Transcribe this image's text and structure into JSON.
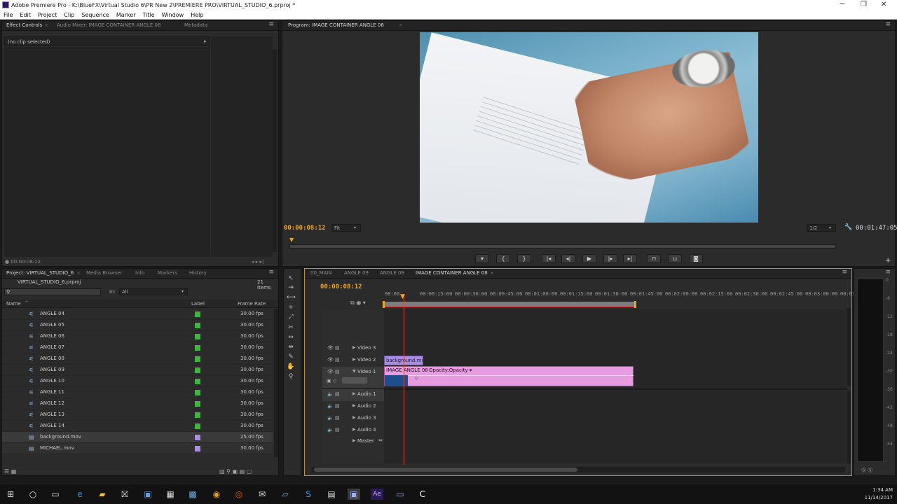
{
  "window": {
    "title": "Adobe Premiere Pro - K:\\BlueFX\\Virtual Studio 6\\PR New 2\\PREMIERE PRO\\VIRTUAL_STUDIO_6.prproj *",
    "minimize": "─",
    "maximize": "❐",
    "close": "✕"
  },
  "menu": [
    "File",
    "Edit",
    "Project",
    "Clip",
    "Sequence",
    "Marker",
    "Title",
    "Window",
    "Help"
  ],
  "source_panel": {
    "tabs": [
      "Effect Controls",
      "Audio Mixer: IMAGE CONTAINER ANGLE 08",
      "Metadata"
    ],
    "no_clip": "(no clip selected)",
    "timecode": "00:00:08:12"
  },
  "program": {
    "tab": "Program: IMAGE CONTAINER ANGLE 08",
    "timecode": "00:00:08:12",
    "fit": "Fit",
    "resolution": "1/2",
    "duration": "00:01:47:05"
  },
  "project": {
    "tabs": [
      "Project: VIRTUAL_STUDIO_6",
      "Media Browser",
      "Info",
      "Markers",
      "History"
    ],
    "filename": "VIRTUAL_STUDIO_6.prproj",
    "item_count": "21 Items",
    "search_placeholder": "",
    "in_label": "In:",
    "in_value": "All",
    "columns": {
      "name": "Name",
      "label": "Label",
      "frame_rate": "Frame Rate"
    },
    "items": [
      {
        "name": "ANGLE 04",
        "fps": "30.00 fps",
        "color": "#3fb43f",
        "kind": "seq"
      },
      {
        "name": "ANGLE 05",
        "fps": "30.00 fps",
        "color": "#3fb43f",
        "kind": "seq"
      },
      {
        "name": "ANGLE 06",
        "fps": "30.00 fps",
        "color": "#3fb43f",
        "kind": "seq"
      },
      {
        "name": "ANGLE 07",
        "fps": "30.00 fps",
        "color": "#3fb43f",
        "kind": "seq"
      },
      {
        "name": "ANGLE 08",
        "fps": "30.00 fps",
        "color": "#3fb43f",
        "kind": "seq"
      },
      {
        "name": "ANGLE 09",
        "fps": "30.00 fps",
        "color": "#3fb43f",
        "kind": "seq"
      },
      {
        "name": "ANGLE 10",
        "fps": "30.00 fps",
        "color": "#3fb43f",
        "kind": "seq"
      },
      {
        "name": "ANGLE 11",
        "fps": "30.00 fps",
        "color": "#3fb43f",
        "kind": "seq"
      },
      {
        "name": "ANGLE 12",
        "fps": "30.00 fps",
        "color": "#3fb43f",
        "kind": "seq"
      },
      {
        "name": "ANGLE 13",
        "fps": "30.00 fps",
        "color": "#3fb43f",
        "kind": "seq"
      },
      {
        "name": "ANGLE 14",
        "fps": "30.00 fps",
        "color": "#3fb43f",
        "kind": "seq"
      },
      {
        "name": "background.mov",
        "fps": "25.00 fps",
        "color": "#a98ee0",
        "kind": "clip"
      },
      {
        "name": "MICHAEL.mov",
        "fps": "30.00 fps",
        "color": "#a98ee0",
        "kind": "clip"
      }
    ]
  },
  "timeline": {
    "tabs": [
      "00_MAIN",
      "ANGLE 09",
      "ANGLE 08",
      "IMAGE CONTAINER ANGLE 08"
    ],
    "timecode": "00:00:08:12",
    "ruler": [
      "00:00",
      "00:00:15:00",
      "00:00:30:00",
      "00:00:45:00",
      "00:01:00:00",
      "00:01:15:00",
      "00:01:30:00",
      "00:01:45:00",
      "00:02:00:00",
      "00:02:15:00",
      "00:02:30:00",
      "00:02:45:00",
      "00:03:00:00",
      "00:03:15"
    ],
    "video_tracks": [
      "Video 3",
      "Video 2",
      "Video 1"
    ],
    "audio_tracks": [
      "Audio 1",
      "Audio 2",
      "Audio 3",
      "Audio 4",
      "Master"
    ],
    "clips": {
      "background": "background.mc",
      "image": "IMAGE ANGLE 08",
      "opacity": "Opacity:Opacity"
    }
  },
  "meter_labels": [
    "0",
    "-6",
    "-12",
    "-18",
    "-24",
    "-30",
    "-36",
    "-42",
    "-48",
    "-54"
  ],
  "taskbar": {
    "time": "1:34 AM",
    "date": "11/14/2017"
  },
  "colors": {
    "accent_timecode": "#e8a42c",
    "clip_pink": "#e79be0",
    "clip_lavender": "#a98ee0",
    "label_green": "#3fb43f",
    "playhead": "#d24a3c"
  }
}
